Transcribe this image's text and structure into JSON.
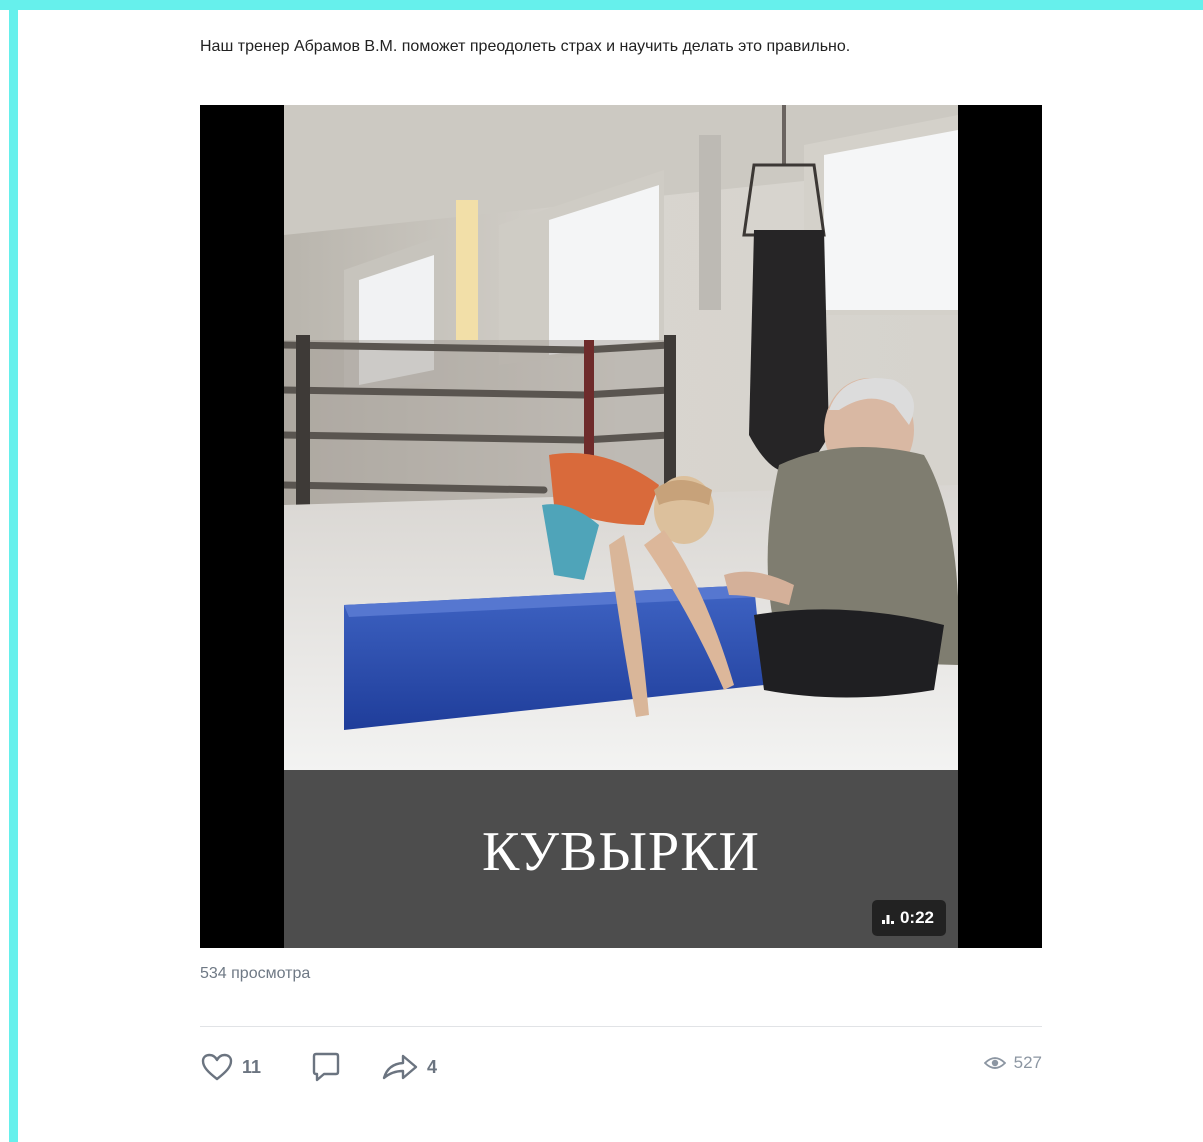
{
  "post": {
    "text": "Наш тренер Абрамов В.М. поможет преодолеть страх и научить делать это правильно."
  },
  "video": {
    "caption": "КУВЫРКИ",
    "duration": "0:22",
    "views_text": "534 просмотра"
  },
  "actions": {
    "likes": "11",
    "shares": "4",
    "views": "527"
  },
  "colors": {
    "frame_accent": "#66f0ec",
    "caption_bg": "#4d4d4d",
    "icon_gray": "#6b7480"
  },
  "icons": [
    "heart-icon",
    "comment-icon",
    "share-icon",
    "eye-icon",
    "equalizer-icon"
  ]
}
